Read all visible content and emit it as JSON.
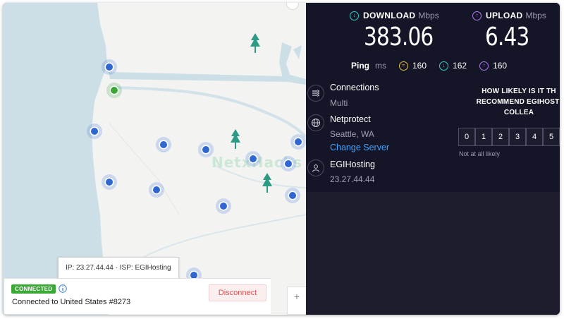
{
  "map": {
    "watermark": "NetxHacks",
    "tooltip": {
      "ip_label": "IP:",
      "ip": "23.27.44.44",
      "separator": "·",
      "isp_label": "ISP:",
      "isp": "EGIHosting"
    },
    "status": {
      "badge": "CONNECTED",
      "connection_text": "Connected to United States #8273",
      "disconnect_label": "Disconnect"
    },
    "zoom_in_label": "+"
  },
  "speed": {
    "download": {
      "label": "DOWNLOAD",
      "unit": "Mbps",
      "value": "383.06",
      "icon": "arrow-down-circle-icon",
      "color": "#35d0c6"
    },
    "upload": {
      "label": "UPLOAD",
      "unit": "Mbps",
      "value": "6.43",
      "icon": "arrow-up-circle-icon",
      "color": "#b07cf0"
    },
    "ping": {
      "label": "Ping",
      "unit": "ms",
      "idle": "160",
      "download": "162",
      "upload": "160",
      "idle_color": "#e8c33c"
    }
  },
  "details": {
    "connections": {
      "title": "Connections",
      "value": "Multi"
    },
    "server": {
      "title": "Netprotect",
      "location": "Seattle, WA",
      "change_label": "Change Server"
    },
    "client": {
      "title": "EGIHosting",
      "ip": "23.27.44.44"
    }
  },
  "survey": {
    "question_line1": "HOW LIKELY IS IT TH",
    "question_line2": "RECOMMEND EGIHOSTI",
    "question_line3": "COLLEA",
    "scale": [
      "0",
      "1",
      "2",
      "3",
      "4",
      "5"
    ],
    "low_label": "Not at all likely"
  }
}
